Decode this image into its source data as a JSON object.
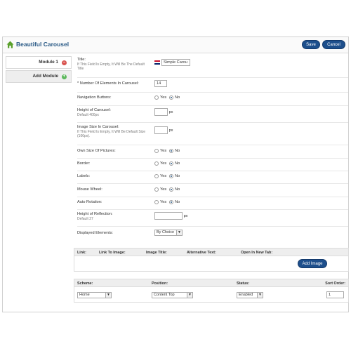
{
  "header": {
    "title": "Beautiful Carousel",
    "save_label": "Save",
    "cancel_label": "Cancel"
  },
  "sidebar": {
    "items": [
      {
        "label": "Module 1",
        "icon": "remove-icon"
      },
      {
        "label": "Add Module",
        "icon": "add-icon"
      }
    ]
  },
  "form": {
    "title": {
      "label": "Title:",
      "hint": "If This Field Is Empty, It Will Be The Default Title",
      "value": "Simple Carou"
    },
    "num_elements": {
      "label": "* Number Of Elements In Carousel:",
      "value": "14"
    },
    "nav_buttons": {
      "label": "Navigation Buttons:",
      "yes": "Yes",
      "no": "No",
      "selected": "No"
    },
    "height": {
      "label": "Height of Carousel:",
      "hint": "Default 400px",
      "value": "",
      "unit": "px"
    },
    "image_size": {
      "label": "Image Size In Carousel:",
      "hint": "If This Field Is Empty, It Will Be Default Size (100px).",
      "value": "",
      "unit": "px"
    },
    "own_size": {
      "label": "Own Size Of Pictures:",
      "yes": "Yes",
      "no": "No",
      "selected": "No"
    },
    "border": {
      "label": "Border:",
      "yes": "Yes",
      "no": "No",
      "selected": "No"
    },
    "labels": {
      "label": "Labels:",
      "yes": "Yes",
      "no": "No",
      "selected": "No"
    },
    "mouse_wheel": {
      "label": "Mouse Wheel:",
      "yes": "Yes",
      "no": "No",
      "selected": "No"
    },
    "auto_rotation": {
      "label": "Auto Rotation:",
      "yes": "Yes",
      "no": "No",
      "selected": "No"
    },
    "reflection": {
      "label": "Height of Reflection:",
      "hint": "Default 27",
      "value": "",
      "unit": "px"
    },
    "displayed": {
      "label": "Displayed Elements:",
      "value": "By Choice"
    }
  },
  "images_table": {
    "columns": [
      "Link:",
      "Link To Image:",
      "Image Title:",
      "Alternative Text:",
      "Open In New Tab:"
    ],
    "add_image_label": "Add Image"
  },
  "position_table": {
    "columns": [
      "Scheme:",
      "Position:",
      "Status:",
      "Sort Order:"
    ],
    "scheme": "Home",
    "position": "Content Top",
    "status": "Enabled",
    "sort_order": "1"
  },
  "colors": {
    "accent": "#1d4f8c",
    "title": "#2a5a86"
  }
}
